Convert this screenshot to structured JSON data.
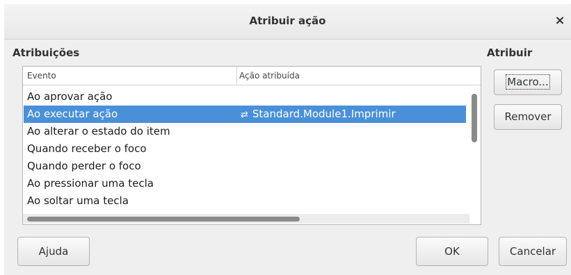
{
  "window": {
    "title": "Atribuir ação",
    "close_glyph": "×"
  },
  "sections": {
    "assignments": "Atribuições",
    "assign": "Atribuir"
  },
  "list": {
    "headers": {
      "event": "Evento",
      "action": "Ação atribuída"
    },
    "rows": [
      {
        "event": "Ao aprovar ação",
        "action": ""
      },
      {
        "event": "Ao executar ação",
        "action": "Standard.Module1.Imprimir",
        "selected": true
      },
      {
        "event": "Ao alterar o estado do item",
        "action": ""
      },
      {
        "event": "Quando receber o foco",
        "action": ""
      },
      {
        "event": "Quando perder o foco",
        "action": ""
      },
      {
        "event": "Ao pressionar uma tecla",
        "action": ""
      },
      {
        "event": "Ao soltar uma tecla",
        "action": ""
      }
    ],
    "selection_color": "#4a90d9"
  },
  "buttons": {
    "macro": "Macro...",
    "remove": "Remover",
    "help": "Ajuda",
    "ok": "OK",
    "cancel": "Cancelar"
  },
  "icons": {
    "close": "close-icon",
    "macro": "macro-link-icon"
  }
}
